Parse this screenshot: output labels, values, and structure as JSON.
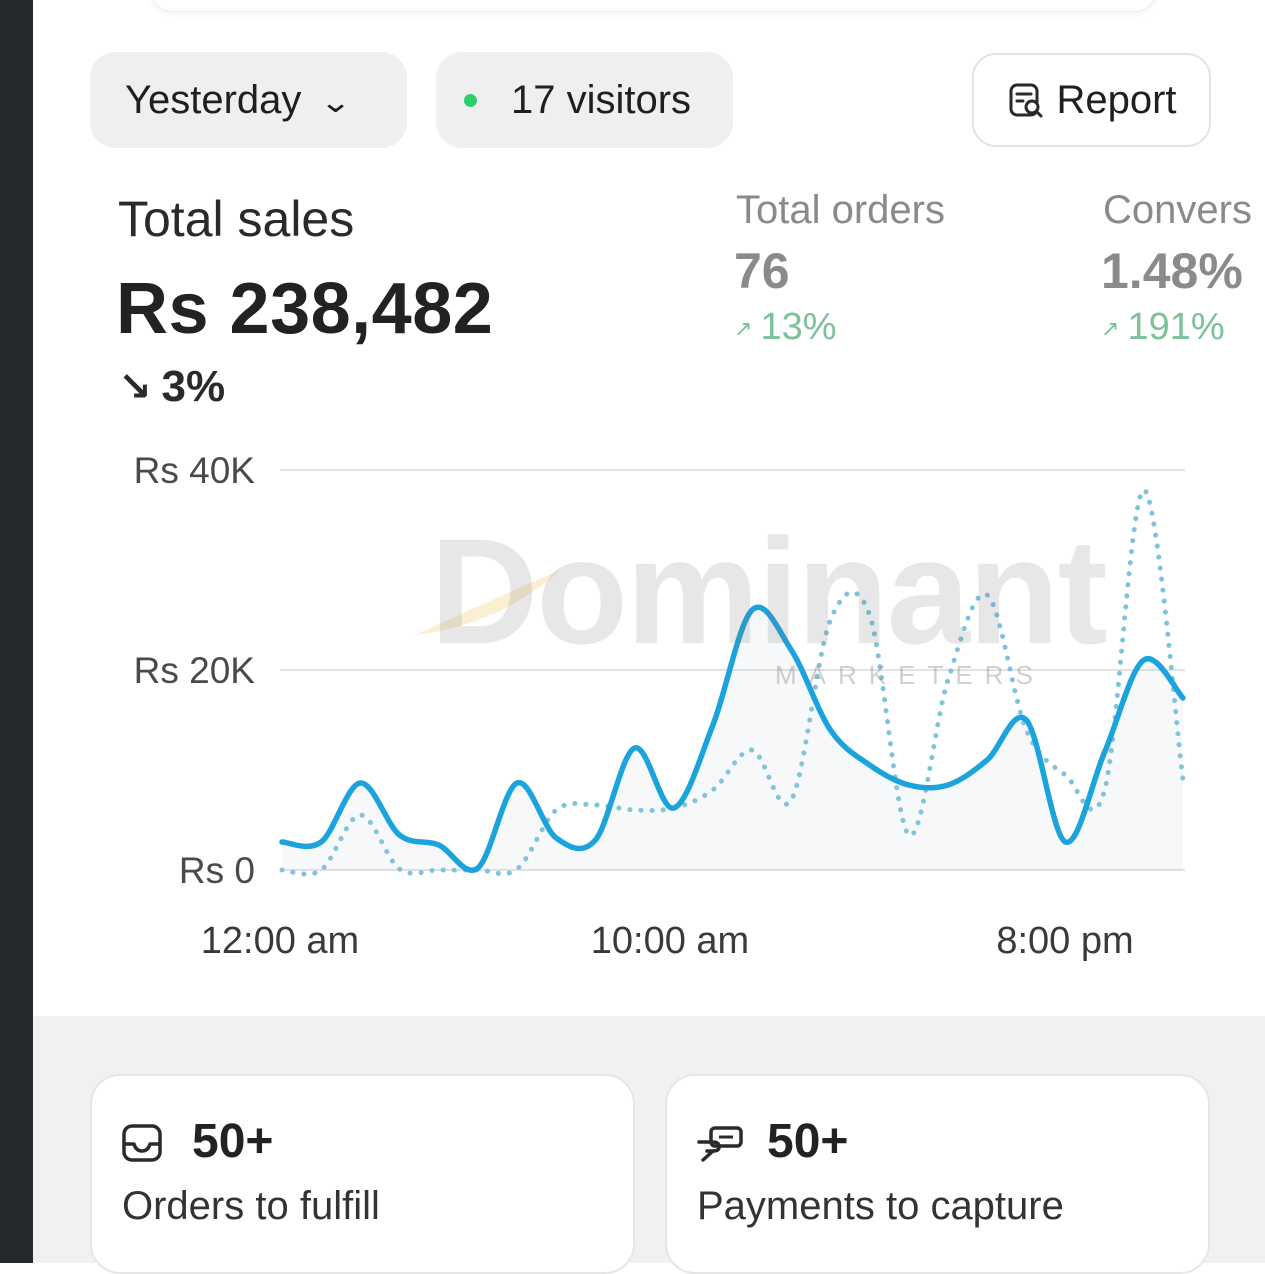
{
  "header": {
    "date_filter": {
      "label": "Yesterday",
      "icon": "chevron-down-icon"
    },
    "visitors": {
      "label": "17 visitors",
      "status_color": "#2ecf6b",
      "icon": "live-dot-icon"
    },
    "report_button": {
      "label": "Report",
      "icon": "report-search-icon"
    }
  },
  "summary": {
    "total_sales": {
      "label": "Total sales",
      "value": "Rs 238,482",
      "change": "3%",
      "direction": "down"
    },
    "total_orders": {
      "label": "Total orders",
      "value": "76",
      "change": "13%",
      "direction": "up"
    },
    "conversion": {
      "label": "Convers",
      "value": "1.48%",
      "change": "191%",
      "direction": "up"
    }
  },
  "watermark": {
    "main": "Dominant",
    "sub": "MARKETERS"
  },
  "chart_data": {
    "type": "line",
    "y_ticks": [
      "Rs 40K",
      "Rs 20K",
      "Rs 0"
    ],
    "x_ticks": [
      "12:00 am",
      "10:00 am",
      "8:00 pm"
    ],
    "ylim": [
      0,
      40000
    ],
    "x_range_hours": [
      0,
      23
    ],
    "grid": true,
    "series": [
      {
        "style": "solid",
        "color": "#1aa3dc",
        "fill": true,
        "x": [
          0,
          1,
          2,
          3,
          4,
          5,
          6,
          7,
          8,
          9,
          10,
          11,
          12,
          13,
          14,
          15,
          16,
          17,
          18,
          19,
          20,
          21,
          22,
          23
        ],
        "values": [
          2800,
          2800,
          8700,
          3500,
          2500,
          200,
          8700,
          3200,
          3000,
          12200,
          6200,
          14500,
          26000,
          22000,
          14000,
          10500,
          8500,
          8500,
          11000,
          15000,
          2800,
          11800,
          21000,
          17200
        ]
      },
      {
        "style": "dotted",
        "color": "#7ec3dd",
        "fill": false,
        "x": [
          0,
          1,
          2,
          3,
          4,
          5,
          6,
          7,
          8,
          9,
          10,
          11,
          12,
          13,
          14,
          15,
          16,
          17,
          18,
          19,
          20,
          21,
          22,
          23
        ],
        "values": [
          0,
          0,
          5500,
          100,
          0,
          0,
          100,
          6000,
          6500,
          6000,
          6200,
          8000,
          12000,
          7000,
          25000,
          25500,
          3500,
          19000,
          27500,
          14000,
          9500,
          8000,
          38000,
          9000
        ]
      }
    ]
  },
  "tiles": [
    {
      "count": "50+",
      "label": "Orders to fulfill",
      "icon": "inbox-icon"
    },
    {
      "count": "50+",
      "label": "Payments to capture",
      "icon": "hand-cash-icon"
    }
  ]
}
